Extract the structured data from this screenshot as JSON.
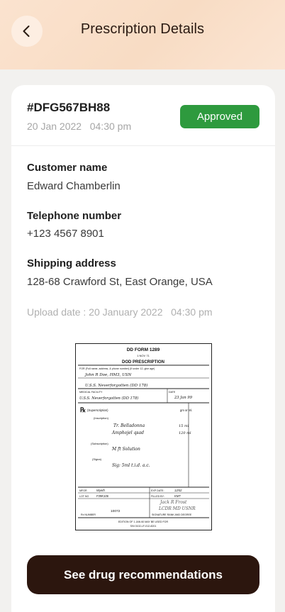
{
  "header": {
    "title": "Prescription Details"
  },
  "order": {
    "id": "#DFG567BH88",
    "date": "20 Jan 2022   04:30 pm",
    "status": "Approved",
    "status_color": "#2e9a3e"
  },
  "customer": {
    "name_label": "Customer name",
    "name": "Edward Chamberlin",
    "phone_label": "Telephone number",
    "phone": "+123 4567 8901",
    "address_label": "Shipping address",
    "address": "128-68 Crawford St, East Orange, USA"
  },
  "upload": {
    "text": "Upload date : 20 January 2022   04:30 pm"
  },
  "prescription_image": {
    "form_no": "DD FORM 1289",
    "form_date": "1 NOV 71",
    "title": "DOD PRESCRIPTION",
    "for_label": "FOR (Full name, address, & phone number) (If under 12, give age)",
    "patient": "John R Doe, HM3, USN",
    "patient_unit": "U.S.S. Neverforgotten  (DD 178)",
    "facility_label": "MEDICAL FACILITY",
    "facility": "U.S.S. Neverforgotten (DD 178)",
    "date_label": "DATE",
    "date": "23 Jan 99",
    "rx": "℞",
    "superscription": "(Superscription)",
    "inscription": "(Inscription)",
    "units": "gm or ml.",
    "drug1": "Tr. Belladonna",
    "drug1_amt": "15 ml",
    "drug2": "Amphojel qsad",
    "drug2_amt": "120 ml",
    "subscription": "(Subscription)",
    "sub_text": "M ft Solution",
    "signa": "(Signa)",
    "signa_text": "Sig: 5ml t.i.d. a.c.",
    "mfgr_label": "MFGR",
    "mfgr": "Wyeth",
    "lot_label": "LOT NO",
    "lot": "F39K106",
    "exp_label": "EXP DATE:",
    "exp": "12/02",
    "filled_label": "FILLED BY:",
    "filled": "KMT",
    "rx_number_label": "Rx NUMBER",
    "rx_number": "10072",
    "signature_label": "SIGNATURE RANK AND DEGREE",
    "signature": "Jack R Frost",
    "rank": "LCDR MD USNR",
    "edition": "EDITION OF 1 JAN 60 MAY BE USED FOR",
    "sn": "S/N 0102-LF-012-8201"
  },
  "cta": {
    "label": "See drug recommendations"
  }
}
